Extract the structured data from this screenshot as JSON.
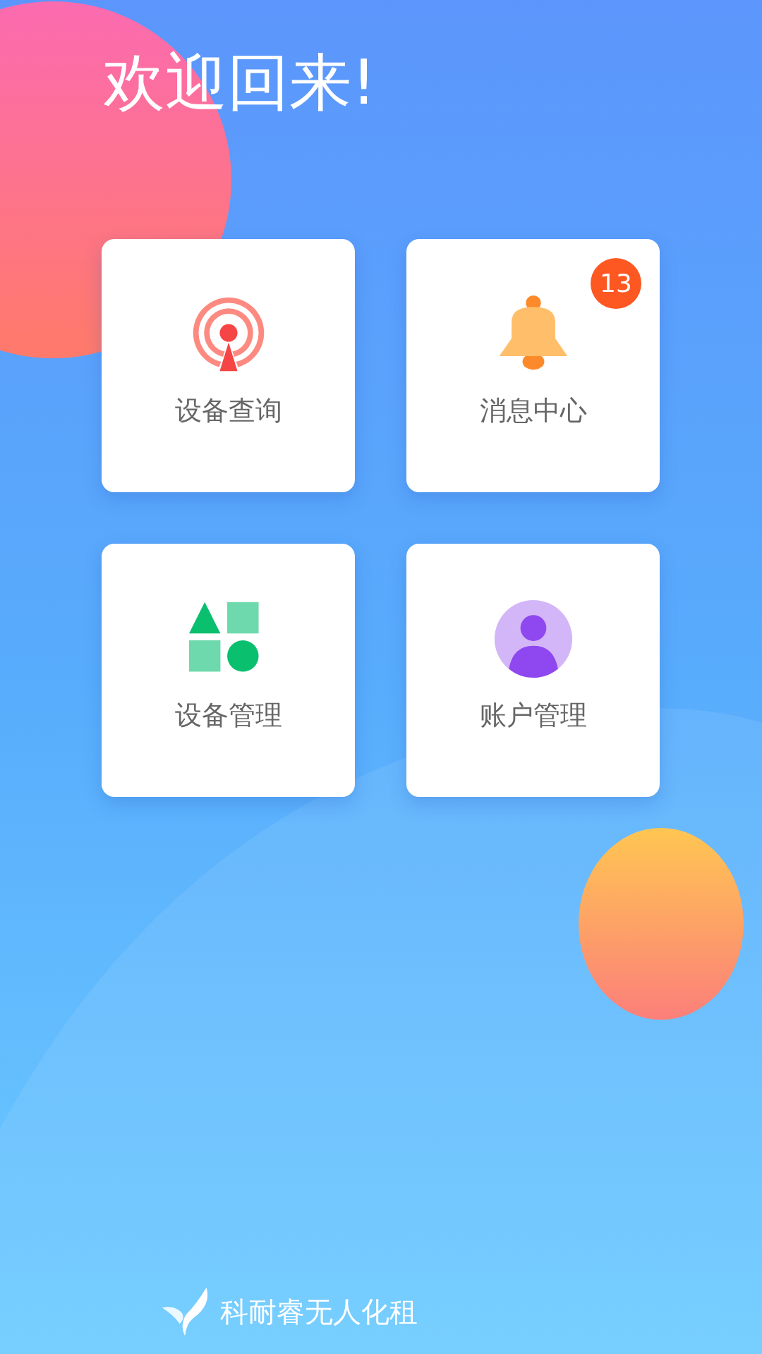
{
  "greeting": "欢迎回来!",
  "message_badge": "13",
  "tiles": [
    {
      "kind": "radar",
      "label": "设备查询"
    },
    {
      "kind": "bell",
      "label": "消息中心"
    },
    {
      "kind": "shapes",
      "label": "设备管理"
    },
    {
      "kind": "user",
      "label": "账户管理"
    }
  ],
  "footer": {
    "text": "科耐睿无人化租"
  }
}
